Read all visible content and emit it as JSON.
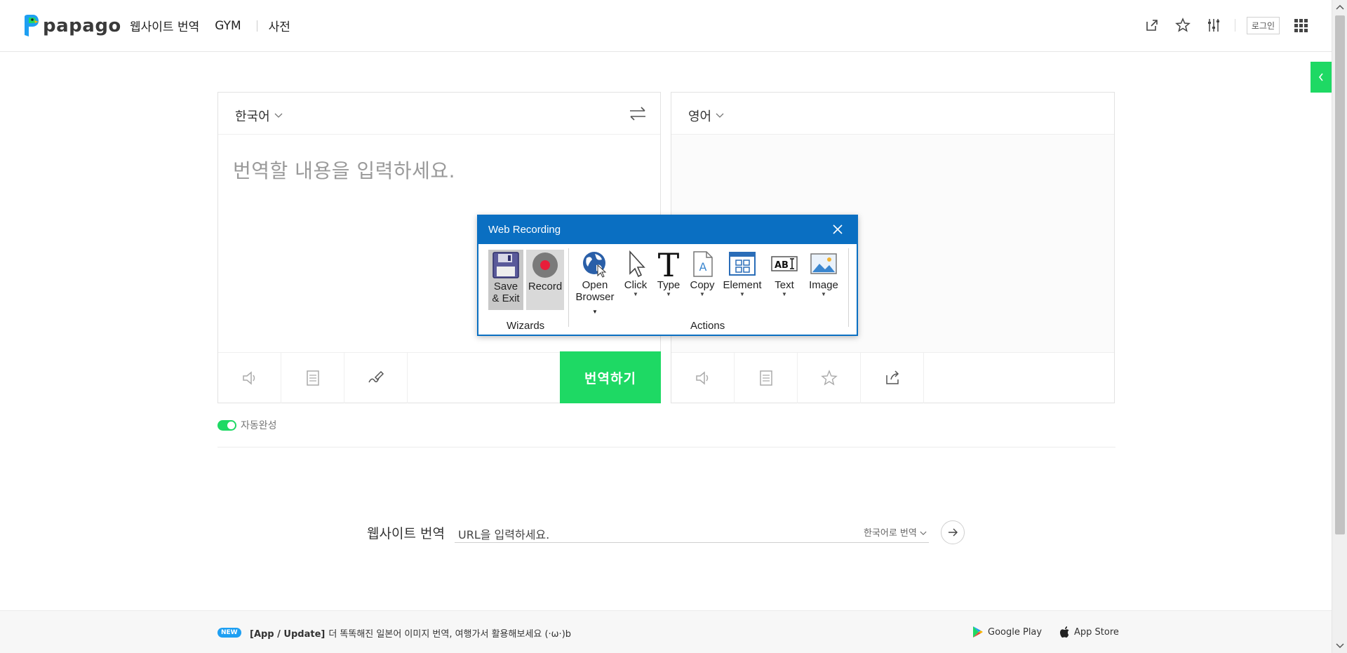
{
  "header": {
    "logo_text": "papago",
    "nav": [
      "웹사이트 번역",
      "GYM",
      "사전"
    ],
    "login_label": "로그인"
  },
  "translator": {
    "source_lang": "한국어",
    "target_lang": "영어",
    "source_placeholder": "번역할 내용을 입력하세요.",
    "translate_label": "번역하기",
    "autocomplete_label": "자동완성"
  },
  "website_translate": {
    "label": "웹사이트 번역",
    "url_placeholder": "URL을 입력하세요.",
    "target_lang": "한국어로 번역"
  },
  "footer": {
    "badge": "NEW",
    "news_tag": "[App / Update]",
    "news_text": "더 똑똑해진 일본어 이미지 번역, 여행가서 활용해보세요 (·ω·)b",
    "google_play": "Google Play",
    "app_store": "App Store"
  },
  "dialog": {
    "title": "Web Recording",
    "wizards_group": "Wizards",
    "actions_group": "Actions",
    "buttons": {
      "save_line1": "Save",
      "save_line2": "& Exit",
      "record": "Record",
      "open_line1": "Open",
      "open_line2": "Browser",
      "click": "Click",
      "type": "Type",
      "copy": "Copy",
      "element": "Element",
      "text": "Text",
      "image": "Image"
    }
  },
  "colors": {
    "accent_green": "#1ed964",
    "dialog_blue": "#0a6fc2",
    "new_badge_blue": "#1e9ff2"
  }
}
